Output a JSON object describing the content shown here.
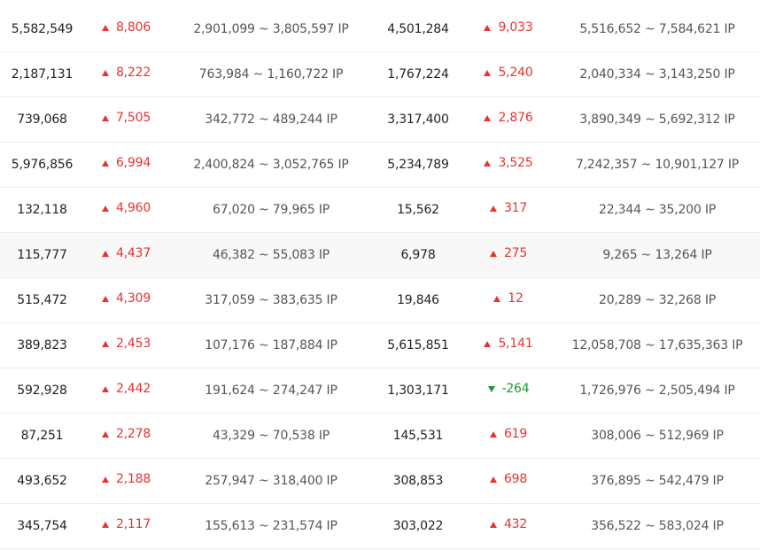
{
  "colors": {
    "up": "#e83131",
    "down": "#1a9a2c",
    "row_highlight": "#f8f8f8",
    "divider": "#ececec"
  },
  "rows": [
    {
      "a_value": "5,582,549",
      "a_change": "8,806",
      "a_dir": "up",
      "a_range": "2,901,099 ~ 3,805,597 IP",
      "b_value": "4,501,284",
      "b_change": "9,033",
      "b_dir": "up",
      "b_range": "5,516,652 ~ 7,584,621 IP"
    },
    {
      "a_value": "2,187,131",
      "a_change": "8,222",
      "a_dir": "up",
      "a_range": "763,984 ~ 1,160,722 IP",
      "b_value": "1,767,224",
      "b_change": "5,240",
      "b_dir": "up",
      "b_range": "2,040,334 ~ 3,143,250 IP"
    },
    {
      "a_value": "739,068",
      "a_change": "7,505",
      "a_dir": "up",
      "a_range": "342,772 ~ 489,244 IP",
      "b_value": "3,317,400",
      "b_change": "2,876",
      "b_dir": "up",
      "b_range": "3,890,349 ~ 5,692,312 IP"
    },
    {
      "a_value": "5,976,856",
      "a_change": "6,994",
      "a_dir": "up",
      "a_range": "2,400,824 ~ 3,052,765 IP",
      "b_value": "5,234,789",
      "b_change": "3,525",
      "b_dir": "up",
      "b_range": "7,242,357 ~ 10,901,127 IP"
    },
    {
      "a_value": "132,118",
      "a_change": "4,960",
      "a_dir": "up",
      "a_range": "67,020 ~ 79,965 IP",
      "b_value": "15,562",
      "b_change": "317",
      "b_dir": "up",
      "b_range": "22,344 ~ 35,200 IP"
    },
    {
      "a_value": "115,777",
      "a_change": "4,437",
      "a_dir": "up",
      "a_range": "46,382 ~ 55,083 IP",
      "b_value": "6,978",
      "b_change": "275",
      "b_dir": "up",
      "b_range": "9,265 ~ 13,264 IP",
      "highlight": true
    },
    {
      "a_value": "515,472",
      "a_change": "4,309",
      "a_dir": "up",
      "a_range": "317,059 ~ 383,635 IP",
      "b_value": "19,846",
      "b_change": "12",
      "b_dir": "up",
      "b_range": "20,289 ~ 32,268 IP"
    },
    {
      "a_value": "389,823",
      "a_change": "2,453",
      "a_dir": "up",
      "a_range": "107,176 ~ 187,884 IP",
      "b_value": "5,615,851",
      "b_change": "5,141",
      "b_dir": "up",
      "b_range": "12,058,708 ~ 17,635,363 IP"
    },
    {
      "a_value": "592,928",
      "a_change": "2,442",
      "a_dir": "up",
      "a_range": "191,624 ~ 274,247 IP",
      "b_value": "1,303,171",
      "b_change": "-264",
      "b_dir": "down",
      "b_range": "1,726,976 ~ 2,505,494 IP"
    },
    {
      "a_value": "87,251",
      "a_change": "2,278",
      "a_dir": "up",
      "a_range": "43,329 ~ 70,538 IP",
      "b_value": "145,531",
      "b_change": "619",
      "b_dir": "up",
      "b_range": "308,006 ~ 512,969 IP"
    },
    {
      "a_value": "493,652",
      "a_change": "2,188",
      "a_dir": "up",
      "a_range": "257,947 ~ 318,400 IP",
      "b_value": "308,853",
      "b_change": "698",
      "b_dir": "up",
      "b_range": "376,895 ~ 542,479 IP"
    },
    {
      "a_value": "345,754",
      "a_change": "2,117",
      "a_dir": "up",
      "a_range": "155,613 ~ 231,574 IP",
      "b_value": "303,022",
      "b_change": "432",
      "b_dir": "up",
      "b_range": "356,522 ~ 583,024 IP"
    }
  ]
}
